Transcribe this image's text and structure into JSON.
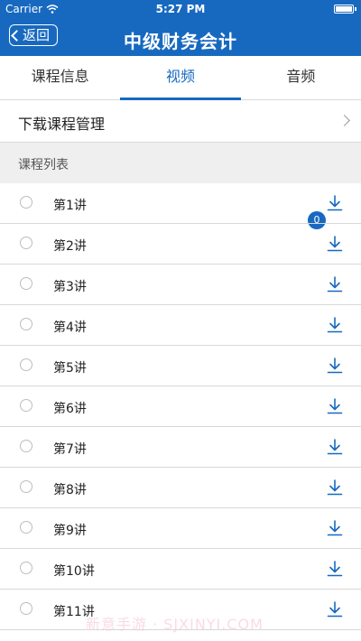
{
  "status_bar": {
    "carrier": "Carrier",
    "time": "5:27 PM"
  },
  "header": {
    "back_label": "返回",
    "title": "中级财务会计"
  },
  "tabs": [
    {
      "label": "课程信息",
      "active": false
    },
    {
      "label": "视频",
      "active": true
    },
    {
      "label": "音频",
      "active": false
    }
  ],
  "download_manage": {
    "label": "下载课程管理",
    "count": "0"
  },
  "course_list": {
    "header": "课程列表",
    "items": [
      "第1讲",
      "第2讲",
      "第3讲",
      "第4讲",
      "第5讲",
      "第6讲",
      "第7讲",
      "第8讲",
      "第9讲",
      "第10讲",
      "第11讲"
    ]
  },
  "watermark": "新意手游 · SJXINYI.COM",
  "colors": {
    "accent": "#1769c0",
    "divider": "#d8d8d8",
    "section_bg": "#efefef"
  }
}
